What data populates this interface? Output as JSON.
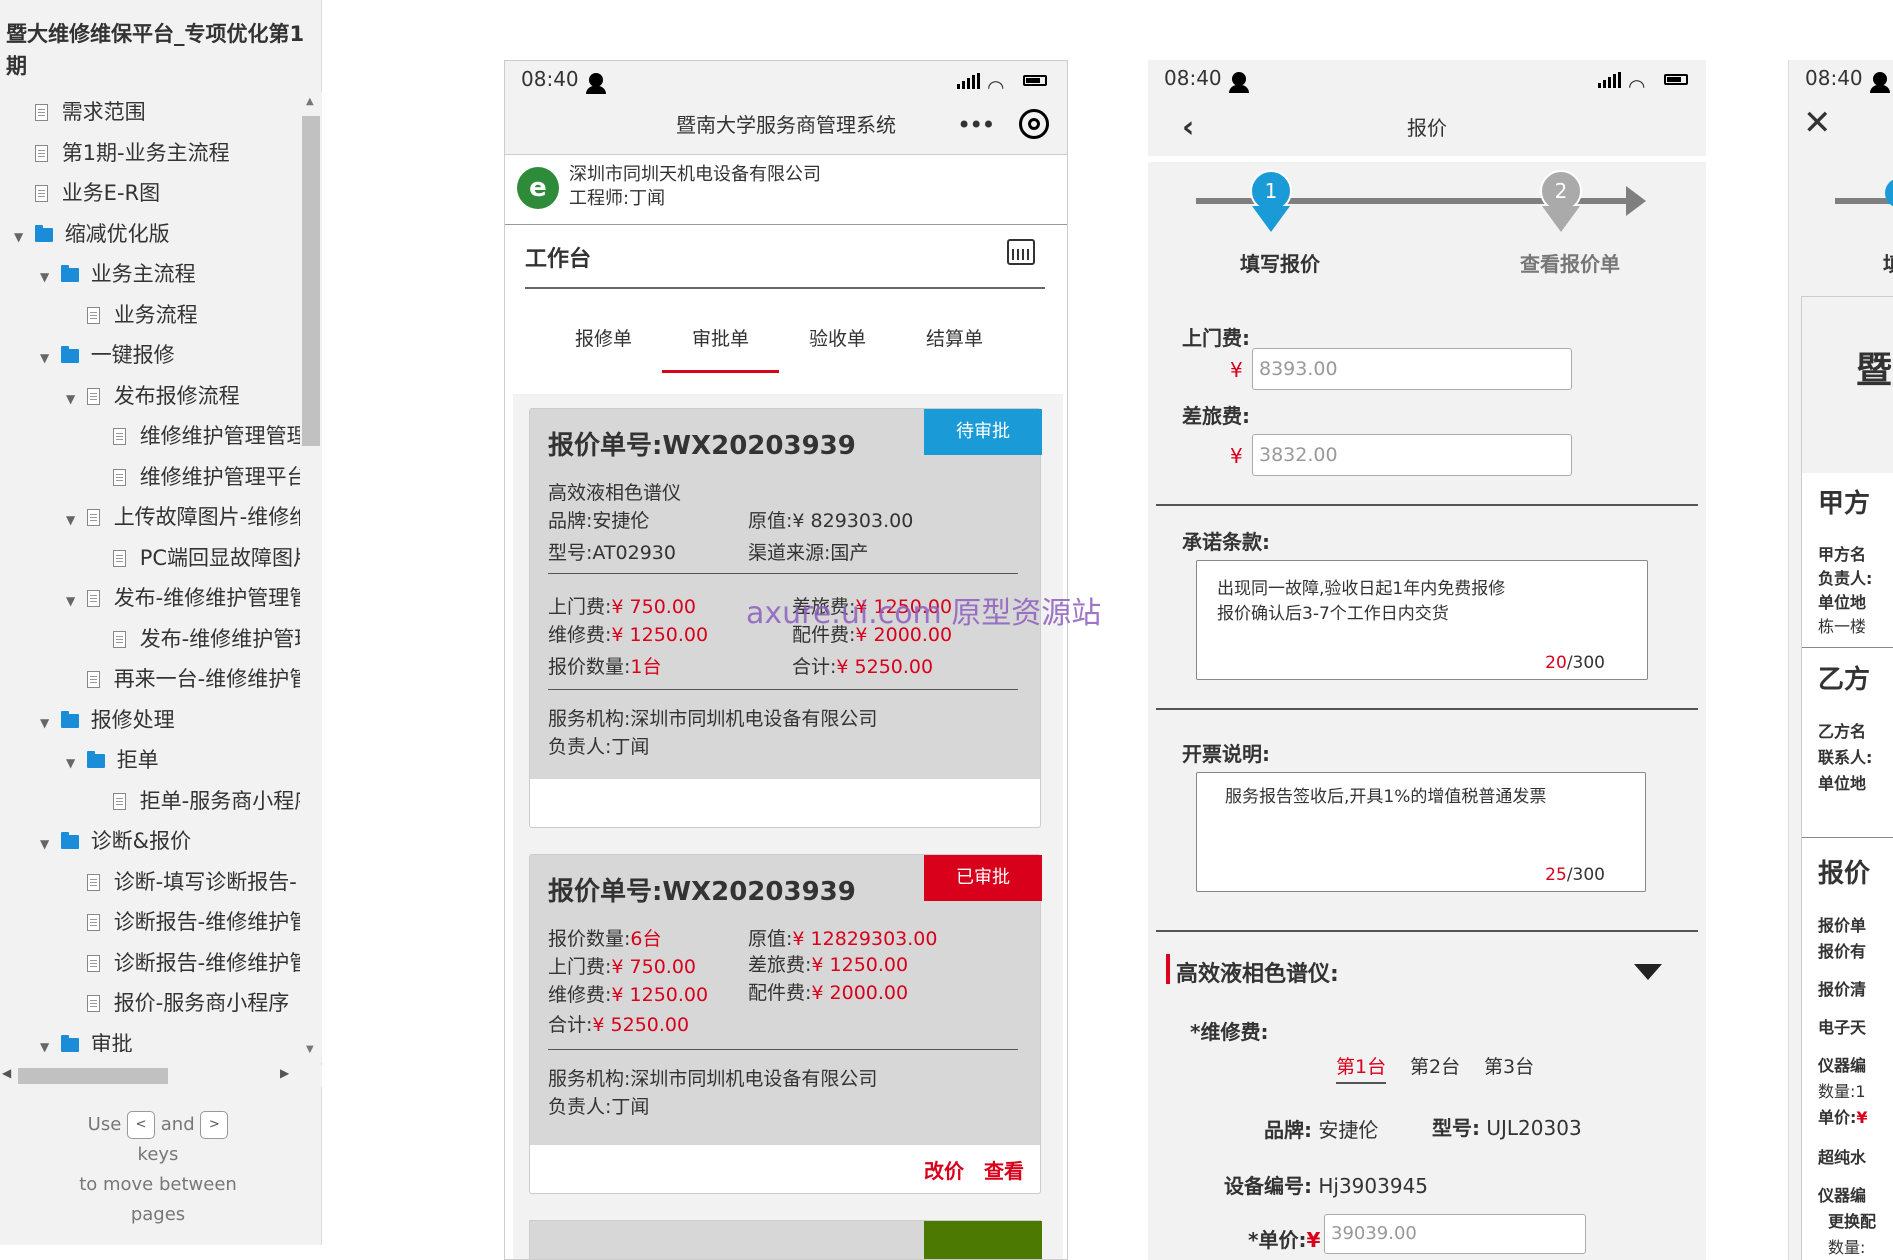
{
  "sidebar": {
    "title": "暨大维修维保平台_专项优化第1期",
    "items": [
      {
        "label": "需求范围",
        "type": "page",
        "level": 0,
        "caret": ""
      },
      {
        "label": "第1期-业务主流程",
        "type": "page",
        "level": 0,
        "caret": ""
      },
      {
        "label": "业务E-R图",
        "type": "page",
        "level": 0,
        "caret": ""
      },
      {
        "label": "缩减优化版",
        "type": "folder",
        "level": 0,
        "caret": "▼"
      },
      {
        "label": "业务主流程",
        "type": "folder",
        "level": 1,
        "caret": "▼"
      },
      {
        "label": "业务流程",
        "type": "page",
        "level": 2,
        "caret": ""
      },
      {
        "label": "一键报修",
        "type": "folder",
        "level": 1,
        "caret": "▼"
      },
      {
        "label": "发布报修流程",
        "type": "page",
        "level": 2,
        "caret": "▼"
      },
      {
        "label": "维修维护管理管理",
        "type": "page",
        "level": 3,
        "caret": ""
      },
      {
        "label": "维修维护管理平台",
        "type": "page",
        "level": 3,
        "caret": ""
      },
      {
        "label": "上传故障图片-维修维",
        "type": "page",
        "level": 2,
        "caret": "▼"
      },
      {
        "label": "PC端回显故障图片",
        "type": "page",
        "level": 3,
        "caret": ""
      },
      {
        "label": "发布-维修维护管理管",
        "type": "page",
        "level": 2,
        "caret": "▼"
      },
      {
        "label": "发布-维修维护管理",
        "type": "page",
        "level": 3,
        "caret": ""
      },
      {
        "label": "再来一台-维修维护管",
        "type": "page",
        "level": 2,
        "caret": ""
      },
      {
        "label": "报修处理",
        "type": "folder",
        "level": 1,
        "caret": "▼"
      },
      {
        "label": "拒单",
        "type": "folder",
        "level": 2,
        "caret": "▼"
      },
      {
        "label": "拒单-服务商小程序",
        "type": "page",
        "level": 3,
        "caret": ""
      },
      {
        "label": "诊断&报价",
        "type": "folder",
        "level": 1,
        "caret": "▼"
      },
      {
        "label": "诊断-填写诊断报告-",
        "type": "page",
        "level": 2,
        "caret": ""
      },
      {
        "label": "诊断报告-维修维护管",
        "type": "page",
        "level": 2,
        "caret": ""
      },
      {
        "label": "诊断报告-维修维护管",
        "type": "page",
        "level": 2,
        "caret": ""
      },
      {
        "label": "报价-服务商小程序",
        "type": "page",
        "level": 2,
        "caret": ""
      },
      {
        "label": "审批",
        "type": "folder",
        "level": 1,
        "caret": "▼"
      }
    ],
    "hint": {
      "use": "Use",
      "and": "and",
      "keys": "keys",
      "line2": "to move between",
      "line3": "pages",
      "key_left": "<",
      "key_right": ">"
    }
  },
  "status": {
    "time": "08:40"
  },
  "phone1": {
    "nav_title": "暨南大学服务商管理系统",
    "more_icon": "•••",
    "company": "深圳市同圳天机电设备有限公司",
    "engineer": "工程师:丁闻",
    "workbench": "工作台",
    "tabs": [
      "报修单",
      "审批单",
      "验收单",
      "结算单"
    ],
    "active_tab": 1,
    "card1": {
      "order_no": "报价单号:WX20203939",
      "status": "待审批",
      "device": "高效液相色谱仪",
      "brand": "品牌:安捷伦",
      "orig_label": "原值:",
      "orig_value": "¥ 829303.00",
      "model": "型号:AT02930",
      "source": "渠道来源:国产",
      "visit_label": "上门费:",
      "visit_value": "¥ 750.00",
      "travel_label": "差旅费:",
      "travel_value": "¥ 1250.00",
      "repair_label": "维修费:",
      "repair_value": "¥ 1250.00",
      "parts_label": "配件费:",
      "parts_value": "¥ 2000.00",
      "qty_label": "报价数量:",
      "qty_value": "1台",
      "total_label": "合计:",
      "total_value": "¥ 5250.00",
      "org": "服务机构:深圳市同圳机电设备有限公司",
      "manager": "负责人:丁闻"
    },
    "card2": {
      "order_no": "报价单号:WX20203939",
      "status": "已审批",
      "qty_label": "报价数量:",
      "qty_value": "6台",
      "orig_label": "原值:",
      "orig_value": "¥ 12829303.00",
      "visit_label": "上门费:",
      "visit_value": "¥ 750.00",
      "travel_label": "差旅费:",
      "travel_value": "¥ 1250.00",
      "repair_label": "维修费:",
      "repair_value": "¥ 1250.00",
      "parts_label": "配件费:",
      "parts_value": "¥ 2000.00",
      "total_label": "合计:",
      "total_value": "¥ 5250.00",
      "org": "服务机构:深圳市同圳机电设备有限公司",
      "manager": "负责人:丁闻",
      "action_edit": "改价",
      "action_view": "查看"
    }
  },
  "watermark": "axure.ui.com 原型资源站",
  "phone2": {
    "nav_title": "报价",
    "steps": [
      {
        "num": "1",
        "label": "填写报价"
      },
      {
        "num": "2",
        "label": "查看报价单"
      }
    ],
    "visit_label": "上门费:",
    "visit_value": "8393.00",
    "travel_label": "差旅费:",
    "travel_value": "3832.00",
    "yen": "¥",
    "promise_label": "承诺条款:",
    "promise_line1": "出现同一故障,验收日起1年内免费报修",
    "promise_line2": "报价确认后3-7个工作日内交货",
    "promise_count": "20",
    "promise_max": "/300",
    "invoice_label": "开票说明:",
    "invoice_text": "服务报告签收后,开具1%的增值税普通发票",
    "invoice_count": "25",
    "invoice_max": "/300",
    "device_title": "高效液相色谱仪:",
    "repair_fee_label": "*维修费:",
    "units": [
      "第1台",
      "第2台",
      "第3台"
    ],
    "brand_label": "品牌:",
    "brand_value": "安捷伦",
    "model_label": "型号:",
    "model_value": "UJL20303",
    "serial_label": "设备编号:",
    "serial_value": "Hj3903945",
    "price_label": "*单价:",
    "price_yen": "¥",
    "price_value": "39039.00"
  },
  "phone3": {
    "step1_label": "填",
    "doc_title": "暨",
    "party_a": "甲方",
    "party_a_name": "甲方名",
    "party_a_person": "负责人:",
    "party_a_addr": "单位地",
    "party_a_bldg": "栋一楼",
    "party_b": "乙方",
    "party_b_name": "乙方名",
    "party_b_contact": "联系人:",
    "party_b_addr": "单位地",
    "quote": "报价",
    "quote_no": "报价单",
    "quote_valid": "报价有",
    "quote_list": "报价清",
    "balance": "电子天",
    "inst_no": "仪器编",
    "qty": "数量:1",
    "unit_price": "单价:",
    "unit_yen": "¥",
    "ultra": "超纯水",
    "inst_no2": "仪器编",
    "replace": "更换配",
    "qty2": "数量:"
  }
}
